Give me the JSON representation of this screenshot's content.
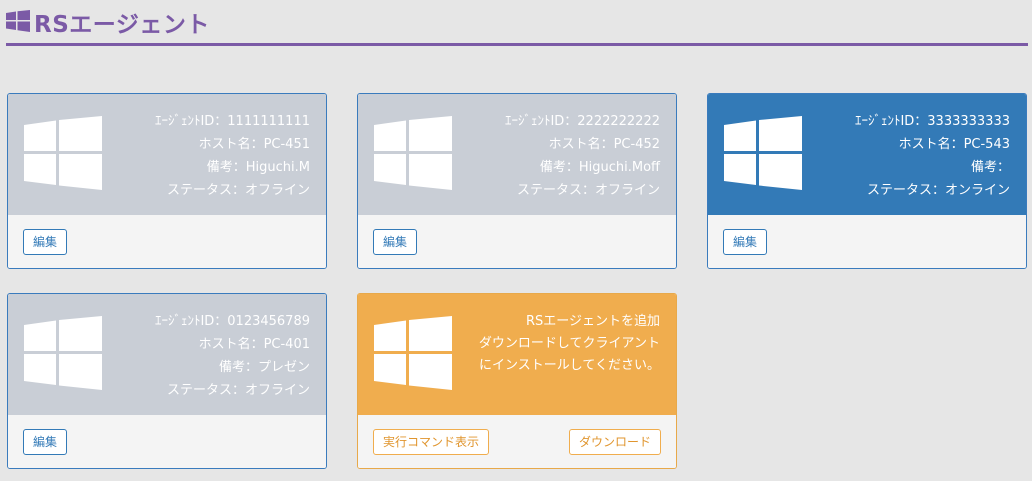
{
  "header": {
    "title": "RSエージェント",
    "logo_icon": "windows-logo-icon",
    "accent": "#7b5aa6"
  },
  "agents": [
    {
      "id_line": "ｴｰｼﾞｪﾝﾄID：1111111111",
      "host_line": "ホスト名：PC-451",
      "note_line": "備考：Higuchi.M",
      "status_line": "ステータス：オフライン",
      "edit_label": "編集",
      "status": "offline"
    },
    {
      "id_line": "ｴｰｼﾞｪﾝﾄID：2222222222",
      "host_line": "ホスト名：PC-452",
      "note_line": "備考：Higuchi.Moff",
      "status_line": "ステータス：オフライン",
      "edit_label": "編集",
      "status": "offline"
    },
    {
      "id_line": "ｴｰｼﾞｪﾝﾄID：3333333333",
      "host_line": "ホスト名：PC-543",
      "note_line": "備考：",
      "status_line": "ステータス：オンライン",
      "edit_label": "編集",
      "status": "online"
    },
    {
      "id_line": "ｴｰｼﾞｪﾝﾄID：0123456789",
      "host_line": "ホスト名：PC-401",
      "note_line": "備考：プレゼン",
      "status_line": "ステータス：オフライン",
      "edit_label": "編集",
      "status": "offline"
    }
  ],
  "add_card": {
    "line1": "RSエージェントを追加",
    "line2": "ダウンロードしてクライアント",
    "line3": "にインストールしてください。",
    "show_command_label": "実行コマンド表示",
    "download_label": "ダウンロード"
  },
  "colors": {
    "offline": "#c9ced6",
    "online": "#337ab7",
    "add": "#f0ad4e",
    "primary": "#337ab7"
  }
}
